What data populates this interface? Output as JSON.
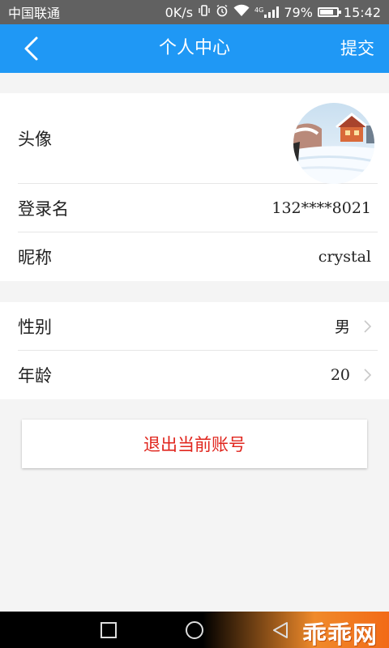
{
  "status_bar": {
    "carrier": "中国联通",
    "speed": "0K/s",
    "network": "4G",
    "battery": "79%",
    "battery_level": 0.79,
    "time": "15:42"
  },
  "header": {
    "title": "个人中心",
    "submit_label": "提交",
    "back_icon": "chevron-left-icon",
    "background_color": "#1f98f5"
  },
  "profile": {
    "avatar_label": "头像",
    "login_name_label": "登录名",
    "login_name_value": "132****8021",
    "nickname_label": "昵称",
    "nickname_value": "crystal"
  },
  "details": {
    "gender_label": "性别",
    "gender_value": "男",
    "age_label": "年龄",
    "age_value": "20"
  },
  "logout": {
    "label": "退出当前账号",
    "color": "#e0251d"
  },
  "watermark": {
    "text": "乖乖网"
  }
}
